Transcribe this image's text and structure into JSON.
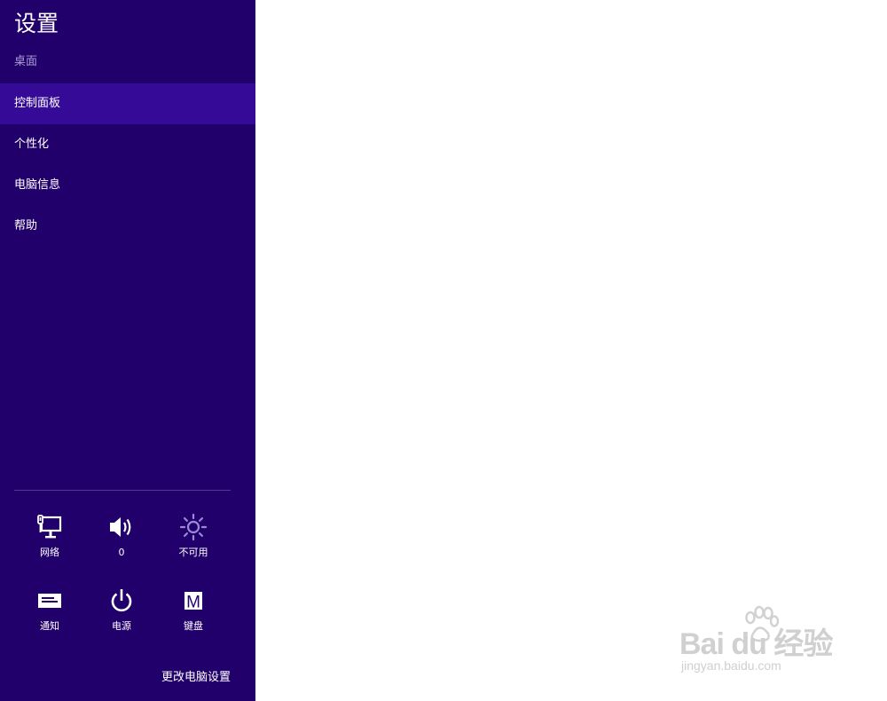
{
  "charm": {
    "title": "设置",
    "subtitle": "桌面",
    "menu": [
      {
        "label": "控制面板",
        "selected": true
      },
      {
        "label": "个性化",
        "selected": false
      },
      {
        "label": "电脑信息",
        "selected": false
      },
      {
        "label": "帮助",
        "selected": false
      }
    ],
    "tiles": [
      {
        "label": "网络",
        "icon": "network-icon"
      },
      {
        "label": "0",
        "icon": "volume-icon"
      },
      {
        "label": "不可用",
        "icon": "brightness-icon"
      },
      {
        "label": "通知",
        "icon": "notification-icon"
      },
      {
        "label": "电源",
        "icon": "power-icon"
      },
      {
        "label": "键盘",
        "icon": "keyboard-icon",
        "glyph": "M"
      }
    ],
    "change_link": "更改电脑设置",
    "colors": {
      "background": "#22006b",
      "selected": "#350a96",
      "subtitle": "#a99bd3"
    }
  },
  "watermark": {
    "brand": "Bai du 经验",
    "url": "jingyan.baidu.com"
  }
}
